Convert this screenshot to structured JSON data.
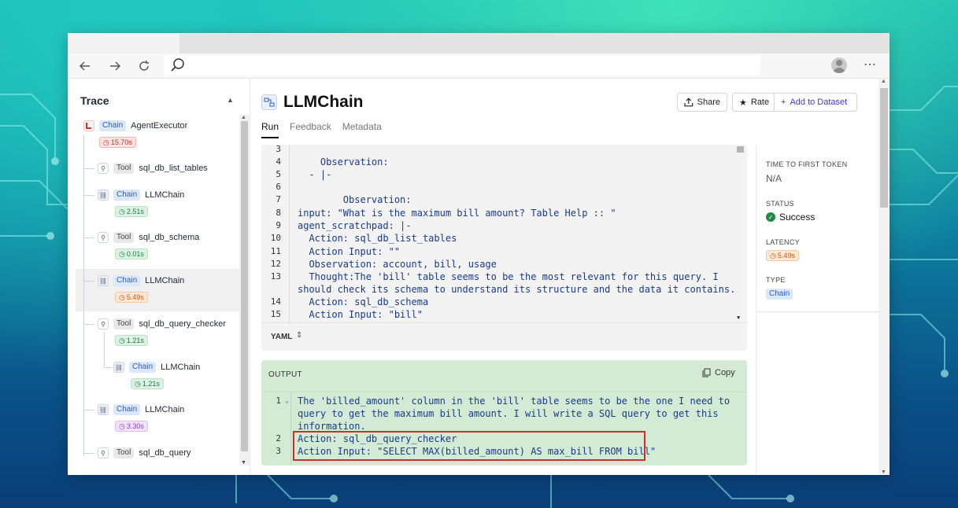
{
  "colors": {
    "accent": "#3b3bd0",
    "chain_badge": "#dbe7fb",
    "output_bg": "#d3ebd5",
    "highlight": "#d42b2b",
    "success": "#1e8c45"
  },
  "sidebar": {
    "title": "Trace",
    "nodes": [
      {
        "type": "Chain",
        "name": "AgentExecutor",
        "time": "15.70s",
        "time_color": "red",
        "icon": "agent-icon"
      },
      {
        "type": "Tool",
        "name": "sql_db_list_tables",
        "icon": "wrench-icon"
      },
      {
        "type": "Chain",
        "name": "LLMChain",
        "time": "2.51s",
        "time_color": "green",
        "icon": "chain-icon"
      },
      {
        "type": "Tool",
        "name": "sql_db_schema",
        "time": "0.01s",
        "time_color": "green",
        "icon": "wrench-icon"
      },
      {
        "type": "Chain",
        "name": "LLMChain",
        "time": "5.49s",
        "time_color": "orange",
        "icon": "chain-icon"
      },
      {
        "type": "Tool",
        "name": "sql_db_query_checker",
        "time": "1.21s",
        "time_color": "green",
        "icon": "wrench-icon"
      },
      {
        "type": "Chain",
        "name": "LLMChain",
        "time": "1.21s",
        "time_color": "green",
        "icon": "chain-icon"
      },
      {
        "type": "Chain",
        "name": "LLMChain",
        "time": "3.30s",
        "time_color": "purple",
        "icon": "chain-icon"
      },
      {
        "type": "Tool",
        "name": "sql_db_query",
        "icon": "wrench-icon"
      }
    ]
  },
  "main": {
    "title": "LLMChain",
    "share_label": "Share",
    "rate_label": "Rate",
    "dataset_label": "Add to Dataset",
    "tabs": [
      {
        "label": "Run"
      },
      {
        "label": "Feedback"
      },
      {
        "label": "Metadata"
      }
    ],
    "input_lines": [
      {
        "num": "3",
        "text": ""
      },
      {
        "num": "4",
        "text": "    Observation:"
      },
      {
        "num": "5",
        "text": "  - |-"
      },
      {
        "num": "6",
        "text": ""
      },
      {
        "num": "7",
        "text": "        Observation:"
      },
      {
        "num": "8",
        "text": "input: \"What is the maximum bill amount? Table Help :: \""
      },
      {
        "num": "9",
        "text": "agent_scratchpad: |-"
      },
      {
        "num": "10",
        "text": "  Action: sql_db_list_tables"
      },
      {
        "num": "11",
        "text": "  Action Input: \"\""
      },
      {
        "num": "12",
        "text": "  Observation: account, bill, usage"
      },
      {
        "num": "13",
        "text": "  Thought:The 'bill' table seems to be the most relevant for this query. I"
      },
      {
        "num": "",
        "text": "should check its schema to understand its structure and the data it contains."
      },
      {
        "num": "14",
        "text": "  Action: sql_db_schema"
      },
      {
        "num": "15",
        "text": "  Action Input: \"bill\""
      }
    ],
    "format_label": "YAML",
    "output": {
      "label": "OUTPUT",
      "copy_label": "Copy",
      "lines": [
        {
          "num": "1",
          "text": "The 'billed_amount' column in the 'bill' table seems to be the one I need to"
        },
        {
          "num": "",
          "text": "query to get the maximum bill amount. I will write a SQL query to get this"
        },
        {
          "num": "",
          "text": "information."
        },
        {
          "num": "2",
          "text": "Action: sql_db_query_checker"
        },
        {
          "num": "3",
          "text": "Action Input: \"SELECT MAX(billed_amount) AS max_bill FROM bill\""
        }
      ]
    }
  },
  "meta": {
    "ttft_label": "TIME TO FIRST TOKEN",
    "ttft_value": "N/A",
    "status_label": "STATUS",
    "status_value": "Success",
    "latency_label": "LATENCY",
    "latency_value": "5.49s",
    "type_label": "TYPE",
    "type_value": "Chain"
  }
}
